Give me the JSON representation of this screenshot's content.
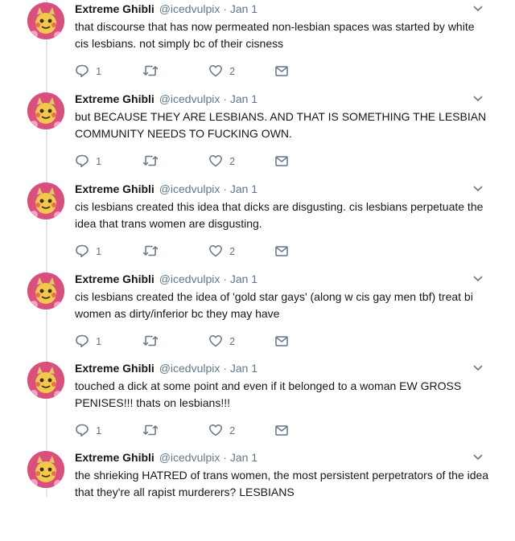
{
  "thread": {
    "tweets": [
      {
        "name": "Extreme Ghibli",
        "handle": "@icedvulpix",
        "separator": "·",
        "date": "Jan 1",
        "text": "that discourse that has now permeated non-lesbian spaces was started by white cis lesbians. not simply bc of their cisness",
        "replies": "1",
        "likes": "2"
      },
      {
        "name": "Extreme Ghibli",
        "handle": "@icedvulpix",
        "separator": "·",
        "date": "Jan 1",
        "text": "but BECAUSE THEY ARE LESBIANS. AND THAT IS SOMETHING THE LESBIAN COMMUNITY NEEDS TO FUCKING OWN.",
        "replies": "1",
        "likes": "2"
      },
      {
        "name": "Extreme Ghibli",
        "handle": "@icedvulpix",
        "separator": "·",
        "date": "Jan 1",
        "text": "cis lesbians created this idea that dicks are disgusting. cis lesbians perpetuate the idea that trans women are disgusting.",
        "replies": "1",
        "likes": "2"
      },
      {
        "name": "Extreme Ghibli",
        "handle": "@icedvulpix",
        "separator": "·",
        "date": "Jan 1",
        "text": "cis lesbians created the idea of 'gold star gays' (along w cis gay men tbf) treat bi women as dirty/inferior bc they may have",
        "replies": "1",
        "likes": "2"
      },
      {
        "name": "Extreme Ghibli",
        "handle": "@icedvulpix",
        "separator": "·",
        "date": "Jan 1",
        "text": "touched a dick at some point and even if it belonged to a woman EW GROSS PENISES!!! thats on lesbians!!!",
        "replies": "1",
        "likes": "2"
      },
      {
        "name": "Extreme Ghibli",
        "handle": "@icedvulpix",
        "separator": "·",
        "date": "Jan 1",
        "text": "the shrieking HATRED of trans women, the most persistent perpetrators of the idea that they're all rapist murderers? LESBIANS",
        "replies": "",
        "likes": ""
      }
    ]
  },
  "icons": {
    "reply": "reply-icon",
    "retweet": "retweet-icon",
    "like": "heart-icon",
    "dm": "envelope-icon",
    "more": "chevron-down-icon"
  },
  "colors": {
    "text": "#14171a",
    "secondary": "#657786",
    "thread_line": "#e1e8ed",
    "avatar_bg": "#d9507c"
  }
}
